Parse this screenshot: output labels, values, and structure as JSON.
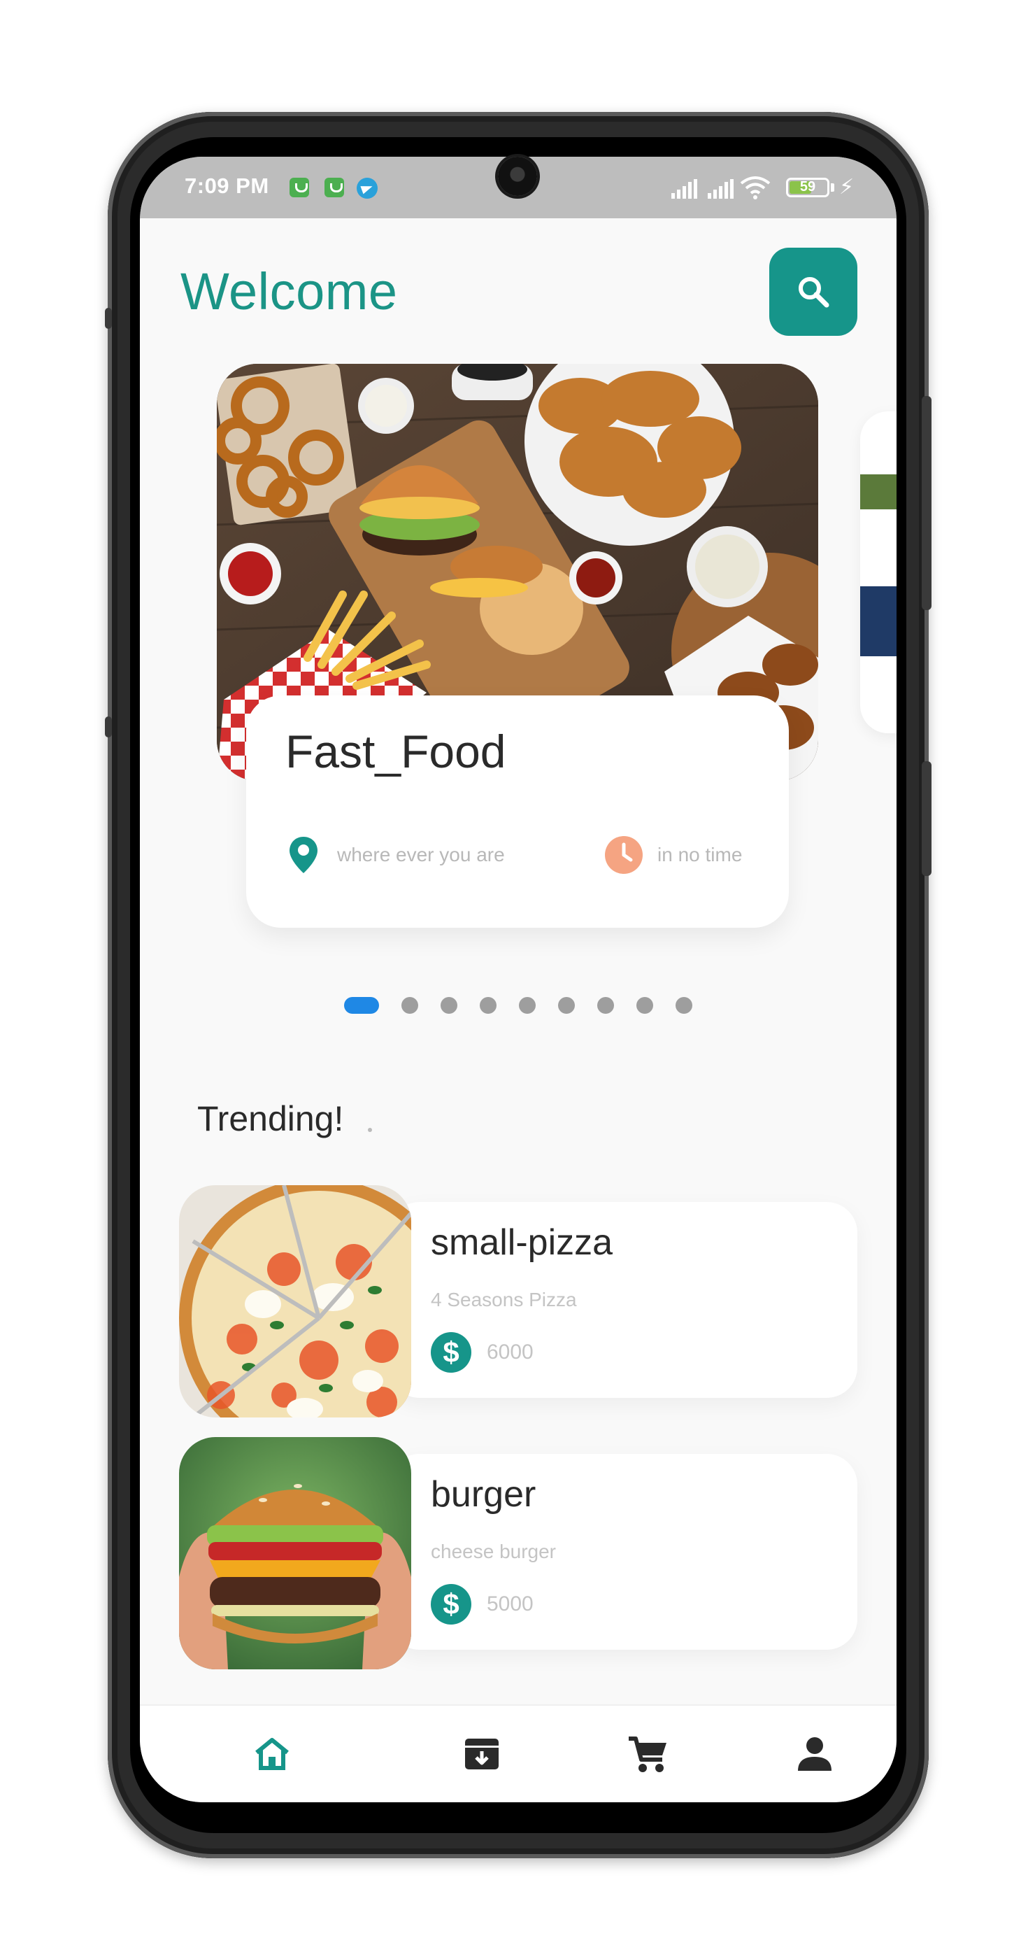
{
  "status_bar": {
    "time": "7:09 PM",
    "battery": "59",
    "battery_level": 0.59
  },
  "header": {
    "title": "Welcome",
    "search_icon": "search-icon",
    "accent_color": "#16958a"
  },
  "carousel": {
    "slides_count": 9,
    "active_index": 0,
    "current": {
      "title": "Fast_Food",
      "location_text": "where ever you are",
      "time_text": "in no time",
      "location_icon": "location-pin-icon",
      "time_icon": "clock-icon"
    }
  },
  "trending": {
    "title": "Trending!",
    "items": [
      {
        "name": "small-pizza",
        "description": "4 Seasons Pizza",
        "price": "6000",
        "price_icon": "dollar-icon"
      },
      {
        "name": "burger",
        "description": "cheese burger",
        "price": "5000",
        "price_icon": "dollar-icon"
      }
    ]
  },
  "bottom_nav": {
    "items": [
      {
        "icon": "home-icon",
        "active": true
      },
      {
        "icon": "archive-icon",
        "active": false
      },
      {
        "icon": "cart-icon",
        "active": false
      },
      {
        "icon": "person-icon",
        "active": false
      }
    ],
    "active_color": "#16958a",
    "inactive_color": "#2a2a2a"
  }
}
